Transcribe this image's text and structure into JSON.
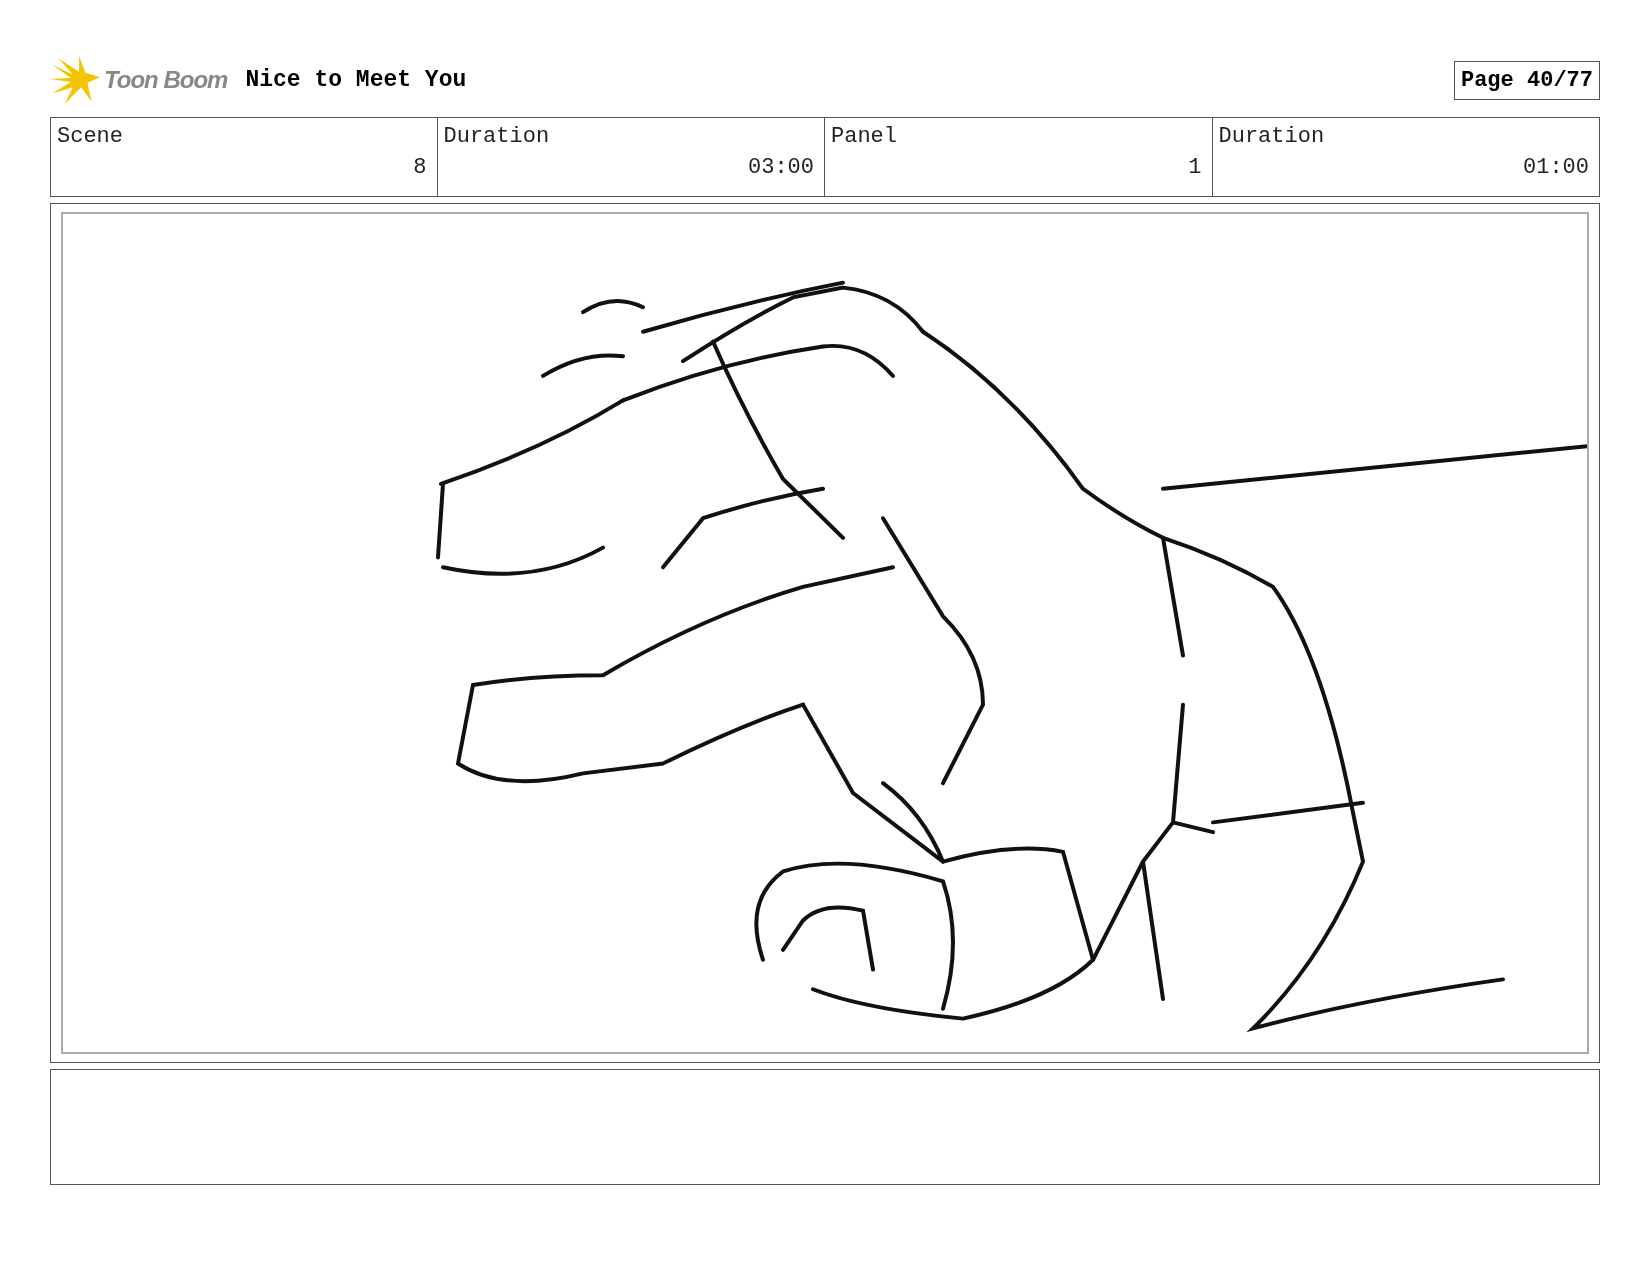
{
  "header": {
    "logo_text": "Toon Boom",
    "title": "Nice to Meet You",
    "page": "Page 40/77"
  },
  "info_table": {
    "columns": [
      "Scene",
      "Duration",
      "Panel",
      "Duration"
    ],
    "rows": [
      [
        "8",
        "03:00",
        "1",
        "01:00"
      ]
    ]
  }
}
